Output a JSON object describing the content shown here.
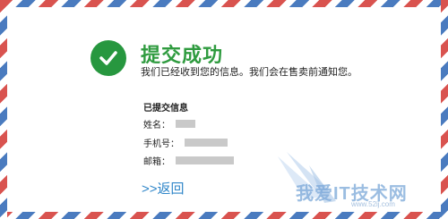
{
  "status": {
    "title": "提交成功",
    "message": "我们已经收到您的信息。我们会在售卖前通知您。"
  },
  "submitted": {
    "heading": "已提交信息",
    "name_label": "姓名：",
    "phone_label": "手机号：",
    "email_label": "邮箱："
  },
  "actions": {
    "back_label": ">>返回"
  },
  "watermark": {
    "text": "我爱IT技术网",
    "url": "www.52ij.com"
  },
  "colors": {
    "accent_green": "#2f9b3f",
    "link_blue": "#2f86c9",
    "stripe_red": "#d9534f",
    "stripe_blue": "#4a7bbf"
  },
  "icons": {
    "success": "check-circle-icon"
  }
}
